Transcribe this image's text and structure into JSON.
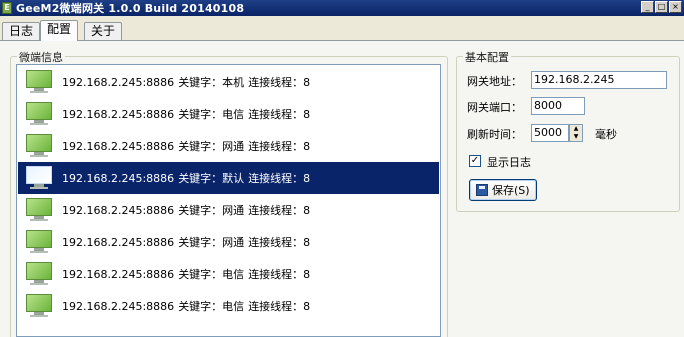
{
  "window": {
    "title": "GeeM2微端网关 1.0.0 Build 20140108",
    "app_icon_letter": "E",
    "minimize_glyph": "_",
    "maximize_glyph": "□",
    "close_glyph": "×"
  },
  "tabs": [
    {
      "label": "日志",
      "active": false
    },
    {
      "label": "配置",
      "active": true
    },
    {
      "label": "关于",
      "active": false
    }
  ],
  "client_group": {
    "title": "微端信息",
    "rows": [
      {
        "address": "192.168.2.245:8886",
        "keyword": "关键字：本机",
        "threads": "连接线程：8",
        "selected": false
      },
      {
        "address": "192.168.2.245:8886",
        "keyword": "关键字：电信",
        "threads": "连接线程：8",
        "selected": false
      },
      {
        "address": "192.168.2.245:8886",
        "keyword": "关键字：网通",
        "threads": "连接线程：8",
        "selected": false
      },
      {
        "address": "192.168.2.245:8886",
        "keyword": "关键字：默认",
        "threads": "连接线程：8",
        "selected": true
      },
      {
        "address": "192.168.2.245:8886",
        "keyword": "关键字：网通",
        "threads": "连接线程：8",
        "selected": false
      },
      {
        "address": "192.168.2.245:8886",
        "keyword": "关键字：网通",
        "threads": "连接线程：8",
        "selected": false
      },
      {
        "address": "192.168.2.245:8886",
        "keyword": "关键字：电信",
        "threads": "连接线程：8",
        "selected": false
      },
      {
        "address": "192.168.2.245:8886",
        "keyword": "关键字：电信",
        "threads": "连接线程：8",
        "selected": false
      }
    ],
    "row_icon": "monitor-icon"
  },
  "config": {
    "title": "基本配置",
    "gateway_address_label": "网关地址：",
    "gateway_address_value": "192.168.2.245",
    "gateway_port_label": "网关端口：",
    "gateway_port_value": "8000",
    "refresh_label": "刷新时间：",
    "refresh_value": "5000",
    "refresh_unit": "毫秒",
    "show_log_label": "显示日志",
    "show_log_checked": true,
    "checkbox_glyph": "✓",
    "save_label": "保存(S)",
    "save_icon": "floppy-disk-icon"
  },
  "colors": {
    "title_bar": "#0a2466",
    "selection": "#0a246a",
    "monitor_green": "#6cb43c"
  }
}
